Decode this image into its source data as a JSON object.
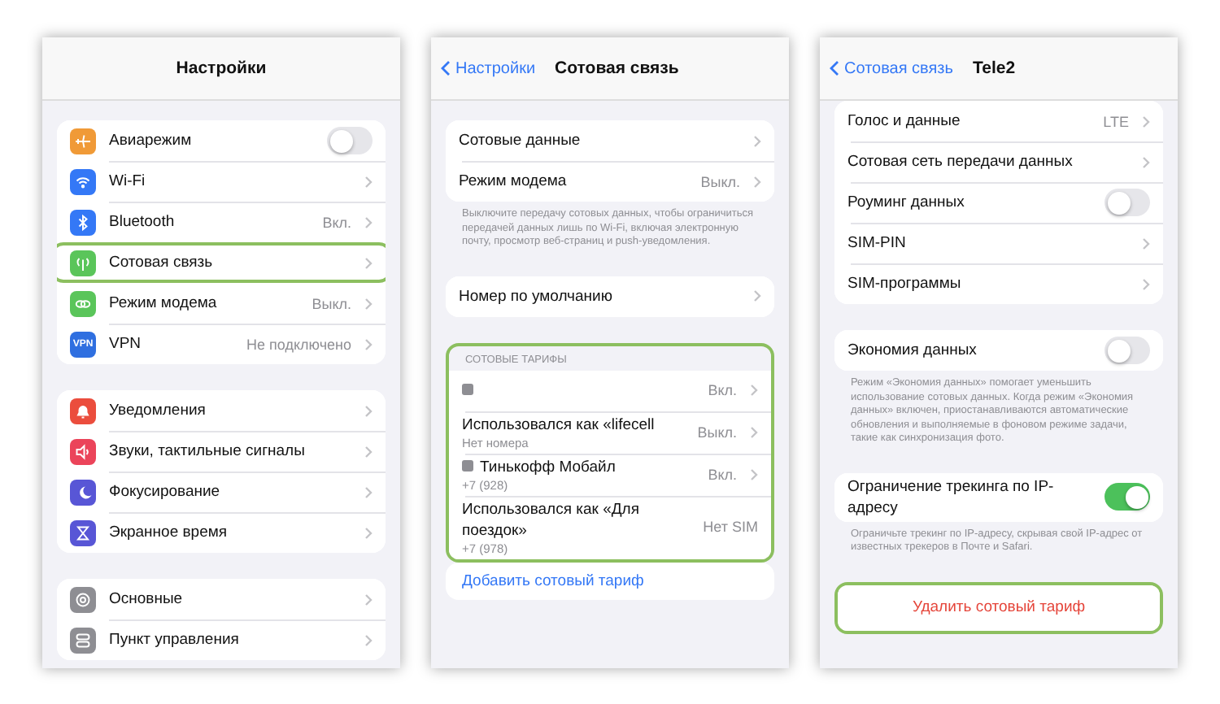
{
  "screens": [
    {
      "nav": {
        "title": "Настройки"
      },
      "sections": [
        {
          "rows": [
            {
              "label": "Авиарежим",
              "icon": {
                "kind": "airplane",
                "color": "#f09a37"
              },
              "toggle": {
                "on": false
              }
            },
            {
              "label": "Wi-Fi",
              "icon": {
                "kind": "wifi",
                "color": "#3478f6"
              },
              "chevron": true
            },
            {
              "label": "Bluetooth",
              "icon": {
                "kind": "bluetooth",
                "color": "#3478f6"
              },
              "value": "Вкл.",
              "chevron": true
            },
            {
              "label": "Сотовая связь",
              "icon": {
                "kind": "antenna",
                "color": "#5ac55a"
              },
              "chevron": true,
              "highlighted": true
            },
            {
              "label": "Режим модема",
              "icon": {
                "kind": "chain",
                "color": "#5ac55a"
              },
              "value": "Выкл.",
              "chevron": true
            },
            {
              "label": "VPN",
              "icon": {
                "kind": "text",
                "color": "#2f6fe0",
                "text": "VPN"
              },
              "value": "Не подключено",
              "chevron": true
            }
          ]
        },
        {
          "rows": [
            {
              "label": "Уведомления",
              "icon": {
                "kind": "bell",
                "color": "#eb4d3d"
              },
              "chevron": true
            },
            {
              "label": "Звуки, тактильные сигналы",
              "icon": {
                "kind": "speaker",
                "color": "#eb445a"
              },
              "chevron": true
            },
            {
              "label": "Фокусирование",
              "icon": {
                "kind": "moon",
                "color": "#5856d6"
              },
              "chevron": true
            },
            {
              "label": "Экранное время",
              "icon": {
                "kind": "hourglass",
                "color": "#5856d6"
              },
              "chevron": true
            }
          ]
        },
        {
          "rows": [
            {
              "label": "Основные",
              "icon": {
                "kind": "gear",
                "color": "#8e8e93"
              },
              "chevron": true
            },
            {
              "label": "Пункт управления",
              "icon": {
                "kind": "switches",
                "color": "#8e8e93"
              },
              "chevron": true
            }
          ]
        }
      ]
    },
    {
      "nav": {
        "back": "Настройки",
        "title": "Сотовая связь"
      },
      "sections": [
        {
          "rows": [
            {
              "label": "Сотовые данные",
              "chevron": true
            },
            {
              "label": "Режим модема",
              "value": "Выкл.",
              "chevron": true
            }
          ],
          "footer": "Выключите передачу сотовых данных, чтобы ограничиться передачей данных лишь по Wi-Fi, включая электронную почту, просмотр веб-страниц и push-уведомления."
        },
        {
          "rows": [
            {
              "label": "Номер по умолчанию",
              "chevron": true
            }
          ]
        },
        {
          "highlighted": true,
          "header": "СОТОВЫЕ ТАРИФЫ",
          "rows": [
            {
              "sim": true,
              "value": "Вкл.",
              "chevron": true
            },
            {
              "label": "Использовался как «lifecell",
              "subtitle": "Нет номера",
              "value": "Выкл.",
              "chevron": true
            },
            {
              "sim": true,
              "label": "Тинькофф Мобайл",
              "subtitle": "+7 (928)",
              "value": "Вкл.",
              "chevron": true
            },
            {
              "label": "Использовался как «Для поездок»",
              "subtitle": "+7 (978)",
              "value": "Нет SIM",
              "chevron": false
            }
          ]
        },
        {
          "attached": true,
          "rows": [
            {
              "kind": "link",
              "label": "Добавить сотовый тариф"
            }
          ]
        }
      ]
    },
    {
      "nav": {
        "back": "Сотовая связь",
        "title": "Tele2"
      },
      "sections": [
        {
          "tight": true,
          "rows": [
            {
              "label": "Голос и данные",
              "value": "LTE",
              "chevron": true
            },
            {
              "label": "Сотовая сеть передачи данных",
              "chevron": true
            },
            {
              "label": "Роуминг данных",
              "toggle": {
                "on": false
              }
            },
            {
              "label": "SIM-PIN",
              "chevron": true
            },
            {
              "label": "SIM-программы",
              "chevron": true
            }
          ]
        },
        {
          "rows": [
            {
              "label": "Экономия данных",
              "toggle": {
                "on": false
              }
            }
          ],
          "footer": "Режим «Экономия данных» помогает уменьшить использование сотовых данных. Когда режим «Экономия данных» включен, приостанавливаются автоматические обновления и выполняемые в фоновом режиме задачи, такие как синхронизация фото."
        },
        {
          "rows": [
            {
              "label": "Ограничение трекинга по IP-адресу",
              "toggle": {
                "on": true
              }
            }
          ],
          "footer": "Ограничьте трекинг по IP-адресу, скрывая свой IP-адрес от известных трекеров в Почте и Safari."
        },
        {
          "highlighted": true,
          "rows": [
            {
              "kind": "action",
              "label": "Удалить сотовый тариф"
            }
          ]
        }
      ]
    }
  ]
}
